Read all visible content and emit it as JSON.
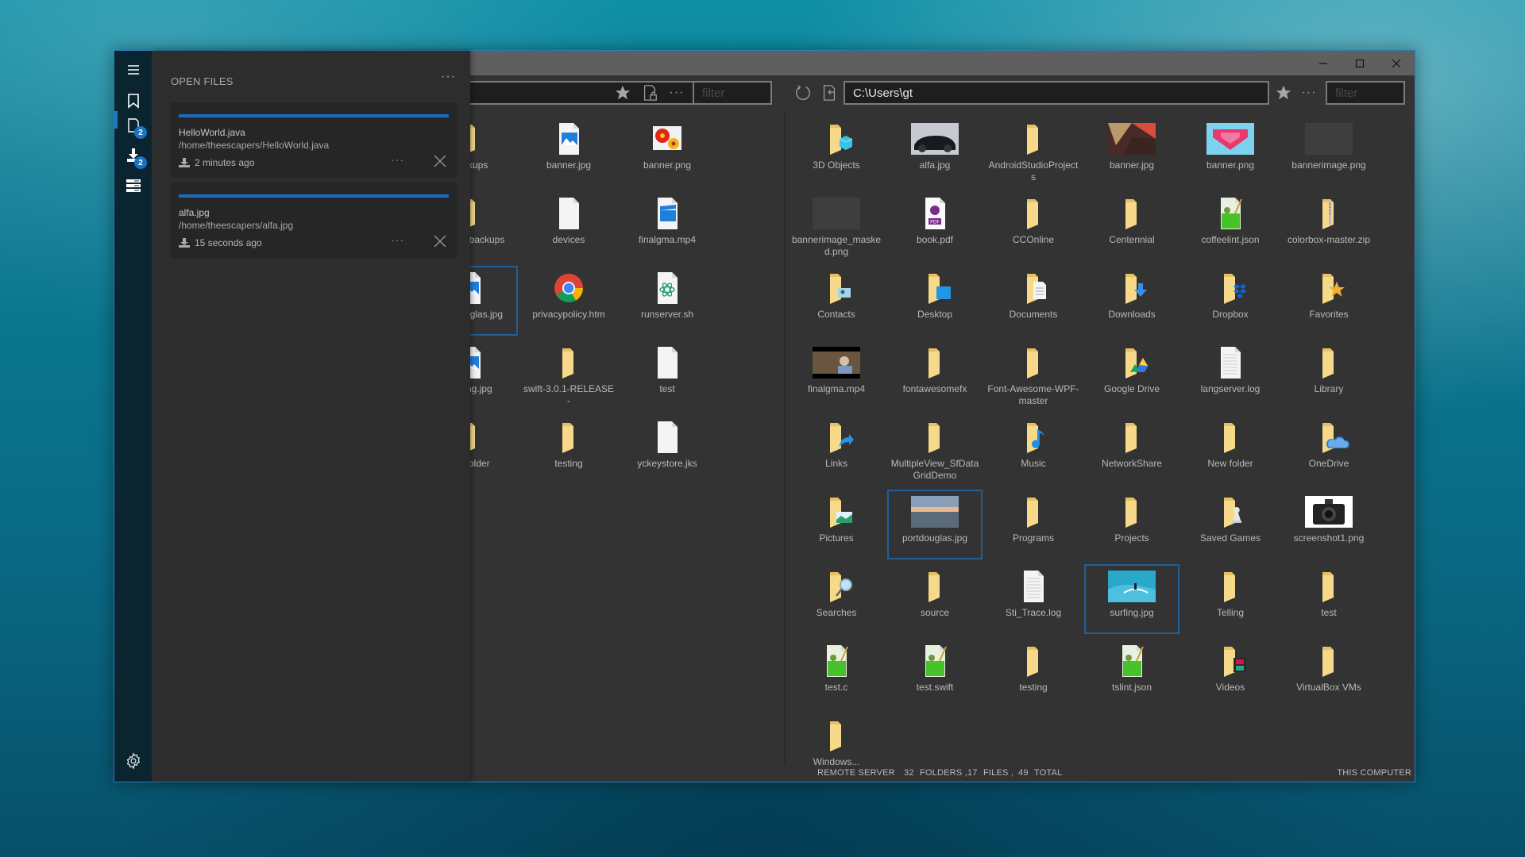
{
  "window": {
    "controls": {
      "minimize": "minimize",
      "maximize": "maximize",
      "close": "close"
    }
  },
  "rail": {
    "items": [
      {
        "name": "menu",
        "icon": "hamburger-icon"
      },
      {
        "name": "bookmarks",
        "icon": "bookmark-icon"
      },
      {
        "name": "open-files",
        "icon": "document-icon",
        "badge": "2",
        "active": true
      },
      {
        "name": "downloads",
        "icon": "download-icon",
        "badge": "2"
      },
      {
        "name": "servers",
        "icon": "server-icon"
      },
      {
        "name": "settings",
        "icon": "gear-icon"
      }
    ]
  },
  "open_files": {
    "title": "OPEN FILES",
    "more": "···",
    "items": [
      {
        "name": "HelloWorld.java",
        "path": "/home/theescapers/HelloWorld.java",
        "time": "2 minutes ago",
        "progress": 1.0,
        "more": "···"
      },
      {
        "name": "alfa.jpg",
        "path": "/home/theescapers/alfa.jpg",
        "time": "15 seconds ago",
        "progress": 1.0,
        "more": "···"
      }
    ]
  },
  "left_pane": {
    "path": "",
    "filter_placeholder": "filter",
    "dots": "···",
    "items": [
      {
        "label": "backups",
        "type": "folder"
      },
      {
        "label": "banner.jpg",
        "type": "image-file"
      },
      {
        "label": "banner.png",
        "type": "flower-image"
      },
      {
        "label": "desktopbackups",
        "type": "folder"
      },
      {
        "label": "devices",
        "type": "file"
      },
      {
        "label": "finalgma.mp4",
        "type": "video-file"
      },
      {
        "label": "portdouglas.jpg",
        "type": "image-file",
        "selected": true
      },
      {
        "label": "privacypolicy.htm",
        "type": "chrome"
      },
      {
        "label": "runserver.sh",
        "type": "atom-file"
      },
      {
        "label": "surfing.jpg",
        "type": "image-file"
      },
      {
        "label": "swift-3.0.1-RELEASE-",
        "type": "folder"
      },
      {
        "label": "test",
        "type": "file"
      },
      {
        "label": "testfolder",
        "type": "folder"
      },
      {
        "label": "testing",
        "type": "folder"
      },
      {
        "label": "yckeystore.jks",
        "type": "file"
      }
    ]
  },
  "right_pane": {
    "path": "C:\\Users\\gt",
    "filter_placeholder": "filter",
    "dots": "···",
    "items": [
      {
        "label": "3D Objects",
        "type": "folder-3d"
      },
      {
        "label": "alfa.jpg",
        "type": "thumb-car"
      },
      {
        "label": "AndroidStudioProjects",
        "type": "folder"
      },
      {
        "label": "banner.jpg",
        "type": "thumb-poly"
      },
      {
        "label": "banner.png",
        "type": "thumb-pink"
      },
      {
        "label": "bannerimage.png",
        "type": "thumb-dark"
      },
      {
        "label": "bannerimage_masked.png",
        "type": "thumb-dark"
      },
      {
        "label": "book.pdf",
        "type": "pdf"
      },
      {
        "label": "CCOnline",
        "type": "folder"
      },
      {
        "label": "Centennial",
        "type": "folder"
      },
      {
        "label": "coffeelint.json",
        "type": "notepad"
      },
      {
        "label": "colorbox-master.zip",
        "type": "zip"
      },
      {
        "label": "Contacts",
        "type": "folder-contacts"
      },
      {
        "label": "Desktop",
        "type": "folder-desktop"
      },
      {
        "label": "Documents",
        "type": "folder-docs"
      },
      {
        "label": "Downloads",
        "type": "folder-downloads"
      },
      {
        "label": "Dropbox",
        "type": "folder-dropbox"
      },
      {
        "label": "Favorites",
        "type": "folder-star"
      },
      {
        "label": "finalgma.mp4",
        "type": "thumb-video"
      },
      {
        "label": "fontawesomefx",
        "type": "folder"
      },
      {
        "label": "Font-Awesome-WPF-master",
        "type": "folder"
      },
      {
        "label": "Google Drive",
        "type": "folder-gdrive"
      },
      {
        "label": "langserver.log",
        "type": "log"
      },
      {
        "label": "Library",
        "type": "folder"
      },
      {
        "label": "Links",
        "type": "folder-links"
      },
      {
        "label": "MultipleView_SfDataGridDemo",
        "type": "folder"
      },
      {
        "label": "Music",
        "type": "folder-music"
      },
      {
        "label": "NetworkShare",
        "type": "folder"
      },
      {
        "label": "New folder",
        "type": "folder"
      },
      {
        "label": "OneDrive",
        "type": "folder-onedrive"
      },
      {
        "label": "Pictures",
        "type": "folder-pictures"
      },
      {
        "label": "portdouglas.jpg",
        "type": "thumb-sunset",
        "selected": true
      },
      {
        "label": "Programs",
        "type": "folder"
      },
      {
        "label": "Projects",
        "type": "folder"
      },
      {
        "label": "Saved Games",
        "type": "folder-games"
      },
      {
        "label": "screenshot1.png",
        "type": "thumb-camera"
      },
      {
        "label": "Searches",
        "type": "folder-search"
      },
      {
        "label": "source",
        "type": "folder"
      },
      {
        "label": "Sti_Trace.log",
        "type": "log"
      },
      {
        "label": "surfing.jpg",
        "type": "thumb-surf",
        "selected": true
      },
      {
        "label": "Telling",
        "type": "folder"
      },
      {
        "label": "test",
        "type": "folder"
      },
      {
        "label": "test.c",
        "type": "notepad"
      },
      {
        "label": "test.swift",
        "type": "notepad"
      },
      {
        "label": "testing",
        "type": "folder"
      },
      {
        "label": "tslint.json",
        "type": "notepad"
      },
      {
        "label": "Videos",
        "type": "folder-videos"
      },
      {
        "label": "VirtualBox VMs",
        "type": "folder"
      },
      {
        "label": "Windows...",
        "type": "folder"
      }
    ]
  },
  "status": {
    "left_location": "REMOTE SERVER",
    "folders_count": "32",
    "folders_label": "FOLDERS ,",
    "files_count": "17",
    "files_label": "FILES ,",
    "total_count": "49",
    "total_label": "TOTAL",
    "right_location": "THIS COMPUTER"
  },
  "colors": {
    "accent": "#1a6cbf",
    "rail": "#0b2530",
    "panel": "#2d2d2d",
    "pane": "#333333",
    "folder": "#f5d57a"
  }
}
